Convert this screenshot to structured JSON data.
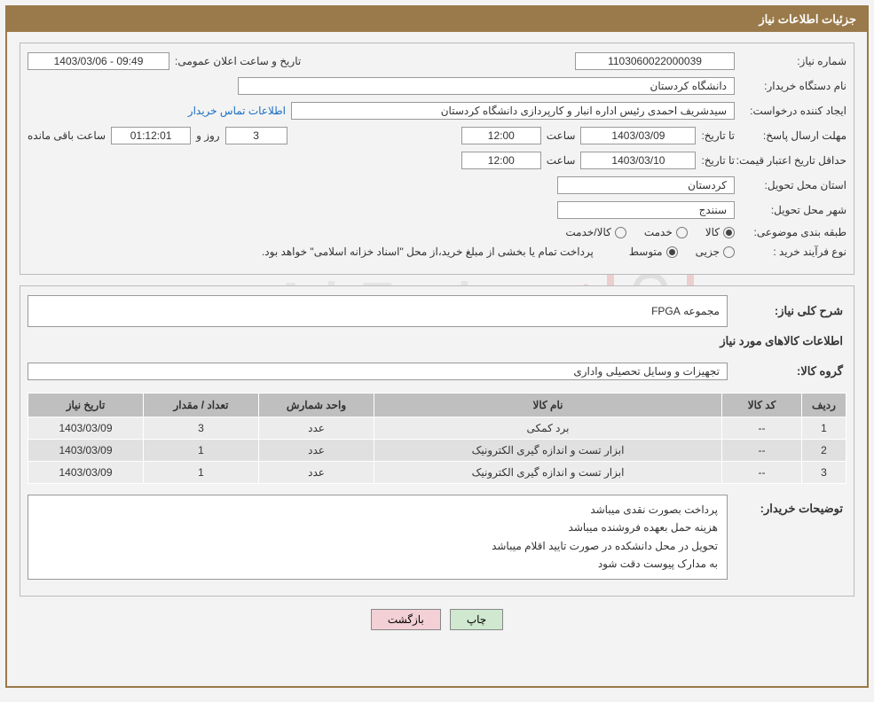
{
  "header": {
    "title": "جزئیات اطلاعات نیاز"
  },
  "info": {
    "need_number_label": "شماره نیاز:",
    "need_number": "1103060022000039",
    "announce_label": "تاریخ و ساعت اعلان عمومی:",
    "announce_value": "09:49 - 1403/03/06",
    "buyer_org_label": "نام دستگاه خریدار:",
    "buyer_org": "دانشگاه کردستان",
    "requester_label": "ایجاد کننده درخواست:",
    "requester": "سیدشریف احمدی رئیس اداره انبار و کارپردازی دانشگاه کردستان",
    "contact_link": "اطلاعات تماس خریدار",
    "deadline_label": "مهلت ارسال پاسخ:",
    "to_date_label": "تا تاریخ:",
    "deadline_date": "1403/03/09",
    "time_label": "ساعت",
    "deadline_time": "12:00",
    "days_value": "3",
    "days_and_label": "روز و",
    "countdown": "01:12:01",
    "remaining_label": "ساعت باقی مانده",
    "validity_label": "حداقل تاریخ اعتبار قیمت:",
    "validity_date": "1403/03/10",
    "validity_time": "12:00",
    "delivery_province_label": "استان محل تحویل:",
    "delivery_province": "کردستان",
    "delivery_city_label": "شهر محل تحویل:",
    "delivery_city": "سنندج",
    "category_label": "طبقه بندی موضوعی:",
    "cat_kala": "کالا",
    "cat_khedmat": "خدمت",
    "cat_kalakhedmat": "کالا/خدمت",
    "process_label": "نوع فرآیند خرید :",
    "proc_jozi": "جزیی",
    "proc_motavaset": "متوسط",
    "process_note": "پرداخت تمام یا بخشی از مبلغ خرید،از محل \"اسناد خزانه اسلامی\" خواهد بود."
  },
  "need": {
    "overall_label": "شرح کلی نیاز:",
    "overall_value": "مجموعه FPGA",
    "items_header": "اطلاعات کالاهای مورد نیاز",
    "group_label": "گروه کالا:",
    "group_value": "تجهیزات و وسایل تحصیلی واداری"
  },
  "table": {
    "headers": [
      "ردیف",
      "کد کالا",
      "نام کالا",
      "واحد شمارش",
      "تعداد / مقدار",
      "تاریخ نیاز"
    ],
    "rows": [
      {
        "idx": "1",
        "code": "--",
        "name": "برد کمکی",
        "unit": "عدد",
        "qty": "3",
        "date": "1403/03/09"
      },
      {
        "idx": "2",
        "code": "--",
        "name": "ابزار تست و اندازه گیری الکترونیک",
        "unit": "عدد",
        "qty": "1",
        "date": "1403/03/09"
      },
      {
        "idx": "3",
        "code": "--",
        "name": "ابزار تست و اندازه گیری الکترونیک",
        "unit": "عدد",
        "qty": "1",
        "date": "1403/03/09"
      }
    ]
  },
  "notes": {
    "label": "توضیحات خریدار:",
    "line1": "پرداخت بصورت نقدی میباشد",
    "line2": "هزینه حمل بعهده فروشنده میباشد",
    "line3": "تحویل در محل دانشکده در صورت تایید اقلام میباشد",
    "line4": "به مدارک پیوست دقت شود"
  },
  "buttons": {
    "print": "چاپ",
    "back": "بازگشت"
  },
  "watermark": {
    "text1": "AriaTender",
    "text2": ".net"
  }
}
